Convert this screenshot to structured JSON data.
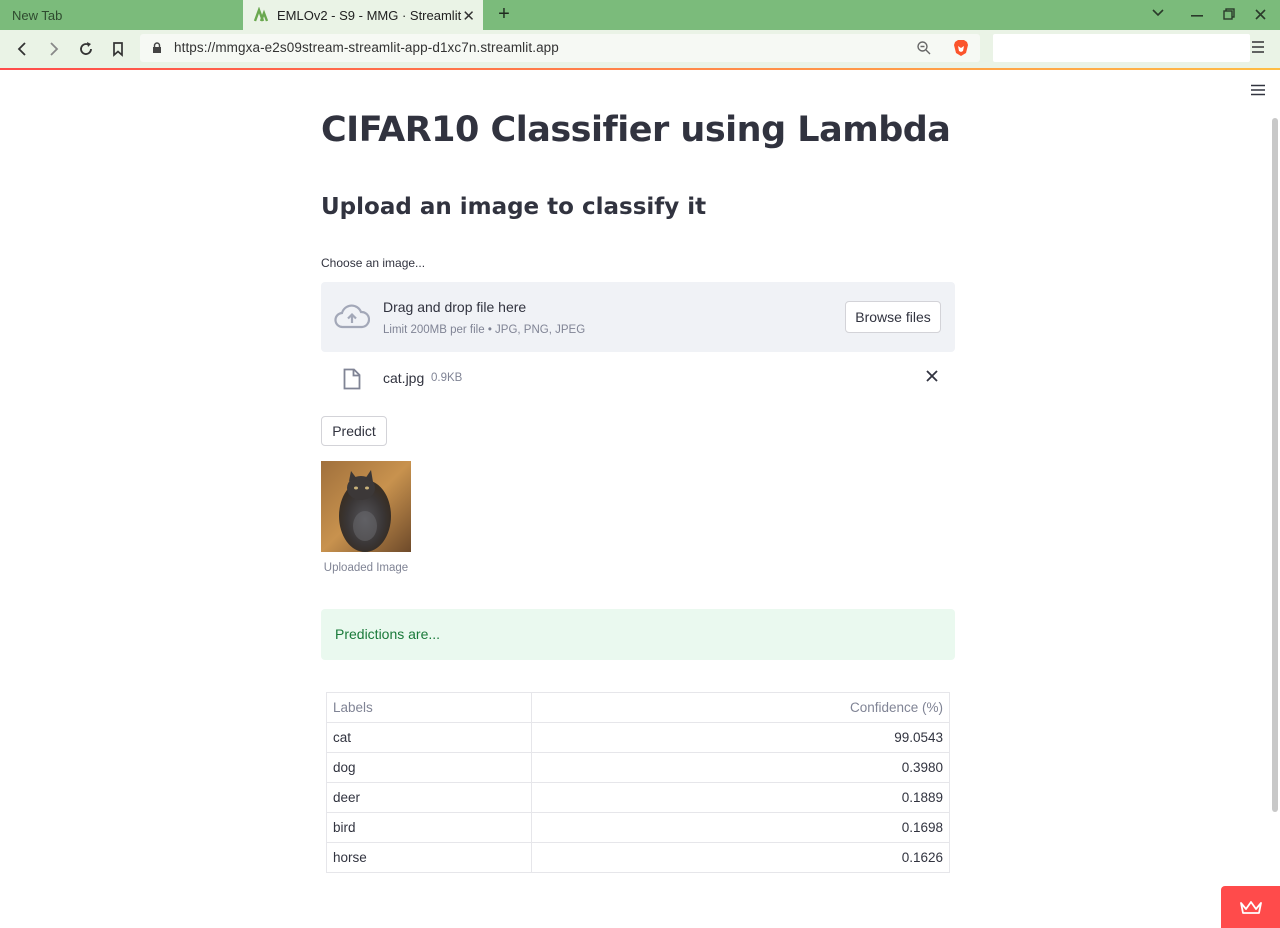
{
  "browser": {
    "tabs": [
      {
        "label": "New Tab",
        "active": false
      },
      {
        "label": "EMLOv2 - S9 - MMG · Streamlit",
        "active": true
      }
    ],
    "new_tab_icon": "plus-icon",
    "url": "https://mmgxa-e2s09stream-streamlit-app-d1xc7n.streamlit.app",
    "search_placeholder": ""
  },
  "app": {
    "title": "CIFAR10 Classifier using Lambda",
    "subtitle": "Upload an image to classify it",
    "uploader": {
      "label": "Choose an image...",
      "drop_title": "Drag and drop file here",
      "drop_subtitle": "Limit 200MB per file • JPG, PNG, JPEG",
      "browse_label": "Browse files",
      "file_name": "cat.jpg",
      "file_size": "0.9KB"
    },
    "predict_label": "Predict",
    "image_caption": "Uploaded Image",
    "success_message": "Predictions are...",
    "table": {
      "headers": [
        "Labels",
        "Confidence (%)"
      ],
      "rows": [
        {
          "label": "cat",
          "confidence": "99.0543"
        },
        {
          "label": "dog",
          "confidence": "0.3980"
        },
        {
          "label": "deer",
          "confidence": "0.1889"
        },
        {
          "label": "bird",
          "confidence": "0.1698"
        },
        {
          "label": "horse",
          "confidence": "0.1626"
        }
      ]
    }
  },
  "colors": {
    "tabbar": "#7bbb7b",
    "accent": "#ff4b4b",
    "success_bg": "#eaf9ef",
    "success_text": "#1a7a3a"
  }
}
